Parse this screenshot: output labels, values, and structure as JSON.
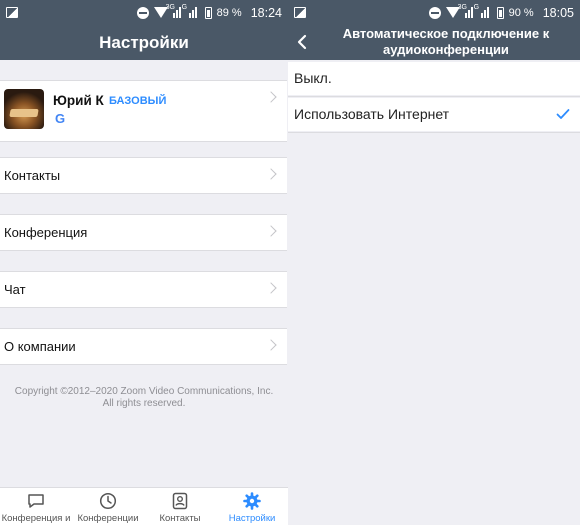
{
  "left": {
    "status": {
      "battery": "89 %",
      "time": "18:24",
      "network": "3G",
      "network2": "G"
    },
    "title": "Настройки",
    "profile": {
      "name": "Юрий К",
      "tier": "БАЗОВЫЙ",
      "account_icon": "google-icon"
    },
    "items": [
      {
        "label": "Контакты"
      },
      {
        "label": "Конференция"
      },
      {
        "label": "Чат"
      },
      {
        "label": "О компании"
      }
    ],
    "copyright": [
      "Copyright ©2012–2020 Zoom Video Communications, Inc.",
      "All rights reserved."
    ],
    "tabs": [
      {
        "label": "Конференция и",
        "icon": "chat-bubble-icon"
      },
      {
        "label": "Конференции",
        "icon": "clock-icon"
      },
      {
        "label": "Контакты",
        "icon": "contact-card-icon"
      },
      {
        "label": "Настройки",
        "icon": "gear-icon",
        "active": true
      }
    ],
    "accent": "#2d8cff",
    "bar_color": "#4a5867"
  },
  "right": {
    "status": {
      "battery": "90 %",
      "time": "18:05",
      "network": "3G",
      "network2": "G"
    },
    "title_lines": [
      "Автоматическое подключение к",
      "аудиоконференции"
    ],
    "options": [
      {
        "label": "Выкл.",
        "selected": false
      },
      {
        "label": "Использовать Интернет",
        "selected": true
      }
    ]
  }
}
